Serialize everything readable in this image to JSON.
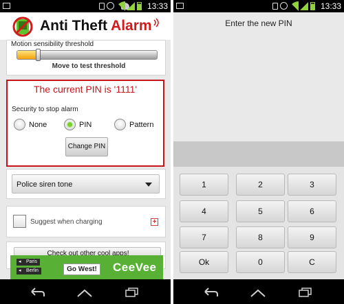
{
  "status_bar": {
    "time": "13:33",
    "icons": [
      "image-icon",
      "android-icon",
      "vibrate-icon",
      "alarm-icon",
      "wifi-icon",
      "signal-icon",
      "battery-icon"
    ]
  },
  "app": {
    "title_main": "Anti Theft",
    "title_accent": "Alarm",
    "brand_color": "#d21a1a"
  },
  "motion": {
    "label": "Motion sensibility threshold",
    "level_percent": 15,
    "caption": "Move to test threshold"
  },
  "pin_panel": {
    "title": "The current PIN is '1111'",
    "security_label": "Security to stop alarm",
    "options": [
      {
        "label": "None",
        "checked": false
      },
      {
        "label": "PIN",
        "checked": true
      },
      {
        "label": "Pattern",
        "checked": false
      }
    ],
    "change_pin_button": "Change PIN"
  },
  "tone_select": {
    "selected": "Police siren tone"
  },
  "suggest": {
    "label": "Suggest when charging",
    "checked": false
  },
  "partial_button": {
    "label": "Check out other cool apps!"
  },
  "ad": {
    "sign_1": "Paris",
    "sign_2": "Berlin",
    "cta": "Go West!",
    "brand": "CeeVee"
  },
  "pin_screen": {
    "prompt": "Enter the new PIN",
    "keys": [
      "1",
      "2",
      "3",
      "4",
      "5",
      "6",
      "7",
      "8",
      "9",
      "Ok",
      "0",
      "C"
    ]
  },
  "nav_icons": [
    "back-icon",
    "home-icon",
    "recent-apps-icon"
  ]
}
